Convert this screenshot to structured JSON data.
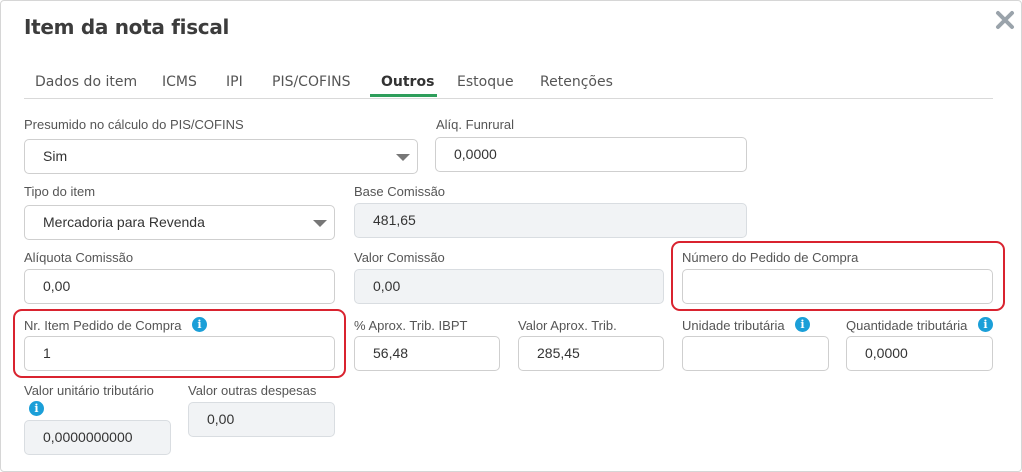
{
  "modal": {
    "title": "Item da nota fiscal"
  },
  "tabs": [
    {
      "label": "Dados do item"
    },
    {
      "label": "ICMS"
    },
    {
      "label": "IPI"
    },
    {
      "label": "PIS/COFINS"
    },
    {
      "label": "Outros"
    },
    {
      "label": "Estoque"
    },
    {
      "label": "Retenções"
    }
  ],
  "active_tab": "Outros",
  "fields": {
    "presumido": {
      "label": "Presumido no cálculo do PIS/COFINS",
      "value": "Sim"
    },
    "aliq_funrural": {
      "label": "Alíq. Funrural",
      "value": "0,0000"
    },
    "tipo_item": {
      "label": "Tipo do item",
      "value": "Mercadoria para Revenda"
    },
    "base_comissao": {
      "label": "Base Comissão",
      "value": "481,65"
    },
    "aliquota_comissao": {
      "label": "Alíquota Comissão",
      "value": "0,00"
    },
    "valor_comissao": {
      "label": "Valor Comissão",
      "value": "0,00"
    },
    "numero_pedido": {
      "label": "Número do Pedido de Compra",
      "value": ""
    },
    "nr_item_pedido": {
      "label": "Nr. Item Pedido de Compra",
      "value": "1"
    },
    "aprox_trib_ibpt": {
      "label": "% Aprox. Trib. IBPT",
      "value": "56,48"
    },
    "valor_aprox_trib": {
      "label": "Valor Aprox. Trib.",
      "value": "285,45"
    },
    "unidade_tributaria": {
      "label": "Unidade tributária",
      "value": ""
    },
    "quantidade_tributaria": {
      "label": "Quantidade tributária",
      "value": "0,0000"
    },
    "valor_unitario_tributario": {
      "label": "Valor unitário tributário",
      "value": "0,0000000000"
    },
    "valor_outras_despesas": {
      "label": "Valor outras despesas",
      "value": "0,00"
    }
  },
  "colors": {
    "accent": "#2e9e5b",
    "info": "#1b9fd8",
    "highlight": "#d9232f",
    "disabled_bg": "#f1f3f5"
  },
  "icons": [
    "close-icon",
    "info-icon",
    "chevron-down-icon"
  ]
}
